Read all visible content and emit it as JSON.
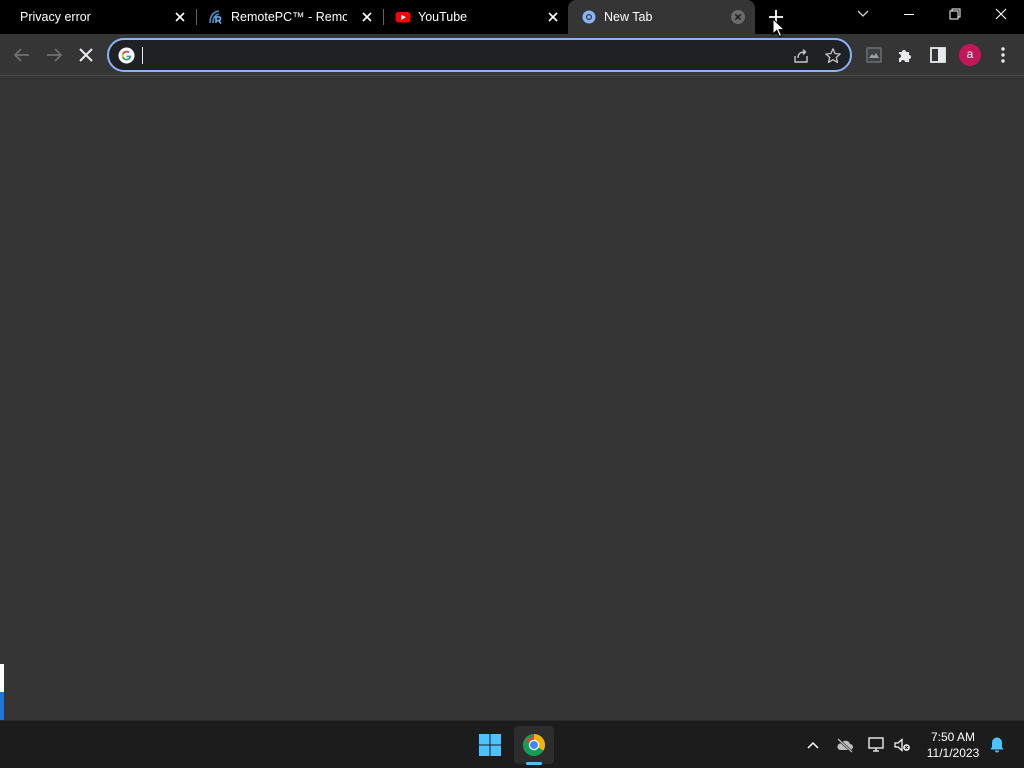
{
  "tabs": [
    {
      "title": "Privacy error",
      "favicon": "none",
      "active": false
    },
    {
      "title": "RemotePC™ - Remote",
      "favicon": "remotepc-logo",
      "active": false
    },
    {
      "title": "YouTube",
      "favicon": "youtube-logo",
      "active": false
    },
    {
      "title": "New Tab",
      "favicon": "chrome-newtab-icon",
      "active": true
    }
  ],
  "new_tab_icon": "plus-icon",
  "window_controls": [
    "tab-search-chevron-icon",
    "minimize-icon",
    "restore-icon",
    "close-icon"
  ],
  "toolbar": {
    "back_icon": "arrow-left-icon",
    "forward_icon": "arrow-right-icon",
    "stop_icon": "stop-loading-x-icon",
    "omnibox": {
      "value": "",
      "placeholder": "",
      "search_engine_icon": "google-g-icon"
    },
    "share_icon": "share-icon",
    "bookmark_icon": "star-icon",
    "extension_icons": [
      "extension-app-icon",
      "puzzle-icon",
      "side-panel-icon"
    ],
    "profile_initial": "a",
    "menu_icon": "kebab-menu-icon"
  },
  "taskbar": {
    "start_icon": "windows-start-icon",
    "pinned": [
      "chrome-icon"
    ],
    "tray": [
      "chevron-up-icon",
      "onedrive-cloud-icon",
      "network-icon",
      "volume-muted-icon"
    ],
    "time": "7:50 AM",
    "date": "11/1/2023",
    "notification_icon": "bell-icon"
  },
  "colors": {
    "tabstrip_bg": "#000000",
    "active_tab_bg": "#353535",
    "content_bg": "#353535",
    "omnibox_border": "#8ab4f8",
    "taskbar_bg": "#1c1c1c",
    "profile_avatar": "#c2185b",
    "accent_blue": "#4cc2ff"
  }
}
